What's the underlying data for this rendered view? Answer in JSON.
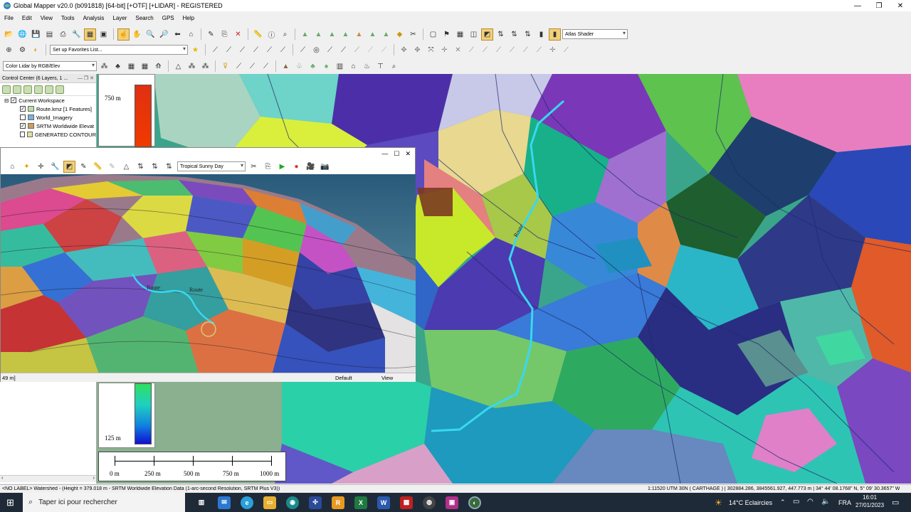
{
  "window": {
    "title": "Global Mapper v20.0 (b091818) [64-bit] [+OTF] [+LIDAR] - REGISTERED"
  },
  "menu": [
    "File",
    "Edit",
    "View",
    "Tools",
    "Analysis",
    "Layer",
    "Search",
    "GPS",
    "Help"
  ],
  "toolbar": {
    "shader": "Atlas Shader",
    "favorites": "Set up Favorites List...",
    "lidar_color": "Color Lidar by RGB/Elev"
  },
  "control_center": {
    "title": "Control Center (6 Layers, 1 ...",
    "workspace": "Current Workspace",
    "layers": [
      {
        "name": "Route.kmz [1 Features]",
        "checked": true,
        "icon": "vector-layer-icon"
      },
      {
        "name": "World_Imagery",
        "checked": false,
        "icon": "imagery-layer-icon"
      },
      {
        "name": "SRTM Worldwide Elevat",
        "checked": true,
        "icon": "elevation-layer-icon"
      },
      {
        "name": "GENERATED CONTOUR",
        "checked": false,
        "icon": "contour-layer-icon"
      }
    ]
  },
  "view3d": {
    "sky": "Tropical Sunny Day",
    "route_labels": [
      "Route",
      "Route"
    ],
    "status_left": "49 m]",
    "status_mid": "Default",
    "status_right": "View"
  },
  "legend": {
    "top_label": "750 m",
    "bottom_label": "125 m"
  },
  "scalebar": {
    "ticks": [
      "0 m",
      "250 m",
      "500 m",
      "750 m",
      "1000 m"
    ]
  },
  "map": {
    "route_label": "Route"
  },
  "statusbar": {
    "left": "<NO LABEL> Watershed - (Height = 379.018 m - SRTM Worldwide Elevation Data (1-arc-second Resolution, SRTM Plus V3))",
    "right": "1:11520  UTM 30N ( CARTHAGE ) | 302884.286, 3845561.927, 447.773 m |  34° 44' 08.1768\" N, 5° 09' 30.3657\" W"
  },
  "taskbar": {
    "search_placeholder": "Taper ici pour rechercher",
    "weather": "14°C  Eclaircies",
    "lang": "FRA",
    "time": "16:01",
    "date": "27/01/2023"
  },
  "colors": {
    "route": "#38d8f0",
    "toolbar_selected": "#f2d07a"
  }
}
